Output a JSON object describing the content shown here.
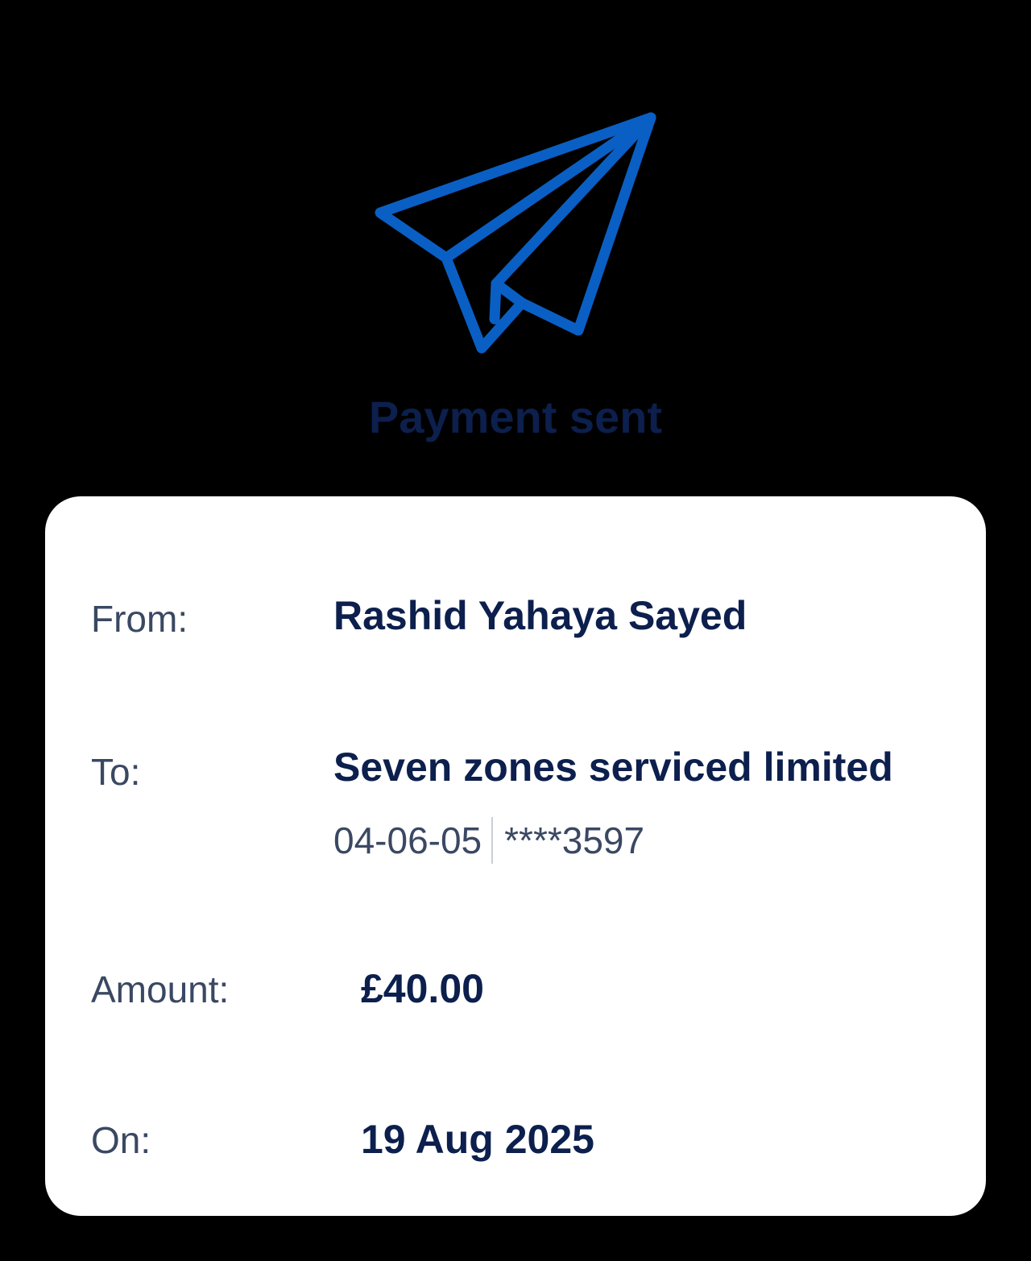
{
  "header": {
    "icon": "paper-plane-icon",
    "title": "Payment sent"
  },
  "details": {
    "from": {
      "label": "From:",
      "value": "Rashid Yahaya Sayed"
    },
    "to": {
      "label": "To:",
      "value": "Seven zones serviced limited",
      "sort_code": "04-06-05",
      "account_number": "****3597"
    },
    "amount": {
      "label": "Amount:",
      "value": "£40.00"
    },
    "on": {
      "label": "On:",
      "value": "19 Aug 2025"
    }
  },
  "colors": {
    "background": "#000000",
    "card": "#ffffff",
    "icon_blue": "#0a5fc4",
    "text_navy": "#0c1f4d",
    "text_gray": "#3a4862"
  }
}
